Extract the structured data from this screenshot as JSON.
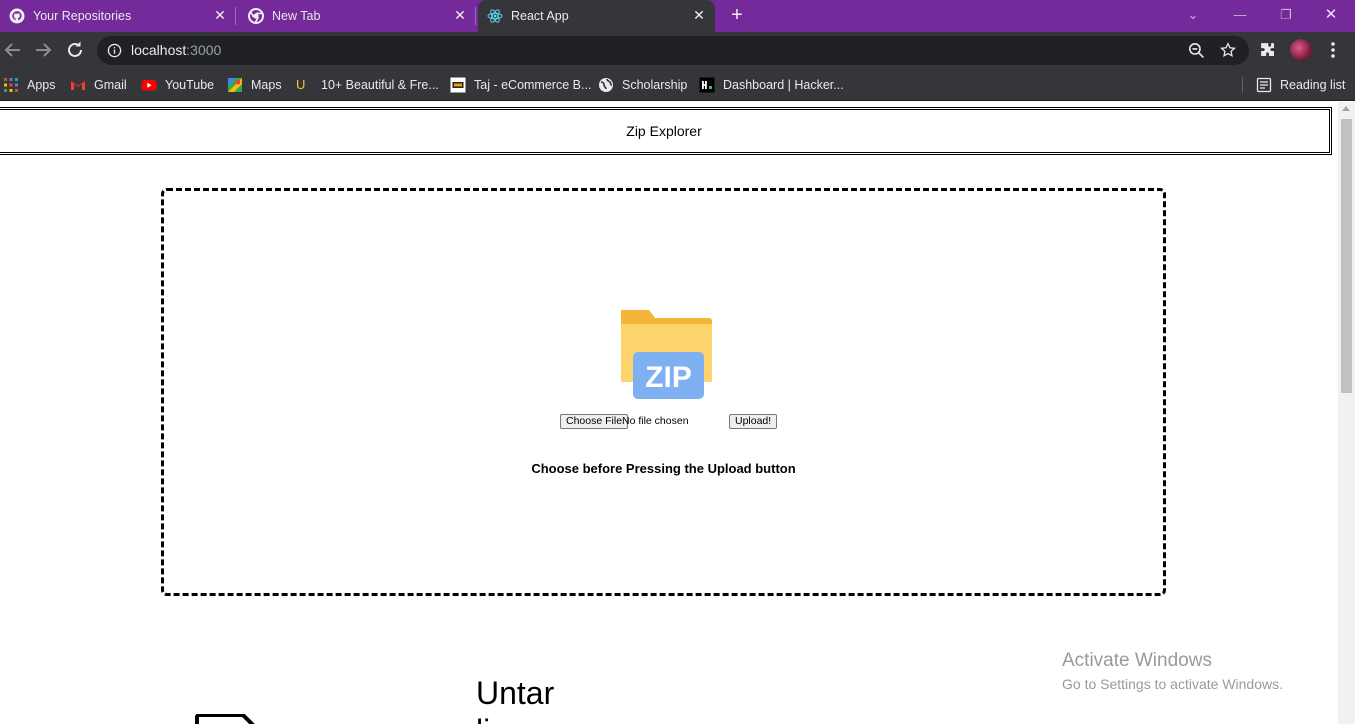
{
  "browser": {
    "tabs": [
      {
        "title": "Your Repositories",
        "icon": "github-icon",
        "active": false
      },
      {
        "title": "New Tab",
        "icon": "chrome-icon",
        "active": false
      },
      {
        "title": "React App",
        "icon": "react-icon",
        "active": true
      }
    ],
    "url_host": "localhost",
    "url_port": ":3000",
    "bookmarks": [
      {
        "label": "Apps",
        "icon": "apps-grid-icon"
      },
      {
        "label": "Gmail",
        "icon": "gmail-icon"
      },
      {
        "label": "YouTube",
        "icon": "youtube-icon"
      },
      {
        "label": "Maps",
        "icon": "maps-icon"
      },
      {
        "label": "10+ Beautiful & Fre...",
        "icon": "u-site-icon"
      },
      {
        "label": "Taj - eCommerce B...",
        "icon": "taj-site-icon"
      },
      {
        "label": "Scholarship",
        "icon": "globe-icon"
      },
      {
        "label": "Dashboard | Hacker...",
        "icon": "hackerrank-icon"
      }
    ],
    "reading_list": "Reading list",
    "colors": {
      "tabstrip": "#742a9a",
      "toolbar": "#35363a",
      "omnibox": "#202124"
    }
  },
  "page": {
    "header_title": "Zip Explorer",
    "zip_icon_label": "ZIP",
    "choose_file_label": "Choose File",
    "no_file_text": "No file chosen",
    "upload_label": "Upload!",
    "hint_text": "Choose before Pressing the Upload button",
    "section_title_line1": "Untar",
    "section_title_line2": "li"
  },
  "os_overlay": {
    "activate_title": "Activate Windows",
    "activate_subtitle": "Go to Settings to activate Windows."
  }
}
